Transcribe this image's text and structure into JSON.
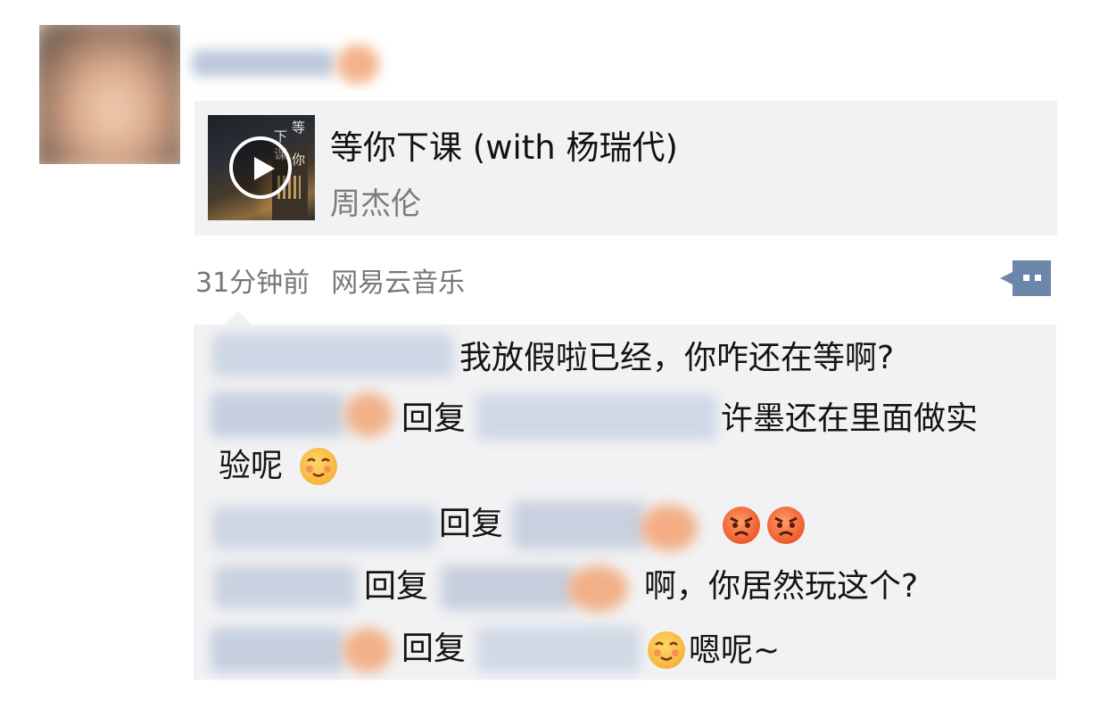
{
  "post": {
    "music": {
      "title": "等你下课 (with 杨瑞代)",
      "artist": "周杰伦",
      "cover_text": [
        "等",
        "你",
        "下",
        "课"
      ]
    },
    "time": "31分钟前",
    "source": "网易云音乐"
  },
  "comments": [
    {
      "text": "我放假啦已经，你咋还在等啊?"
    },
    {
      "reply_label": "回复",
      "text_line1": "许墨还在里面做实",
      "text_line2": "验呢"
    },
    {
      "reply_label": "回复"
    },
    {
      "reply_label": "回复",
      "text": "啊，你居然玩这个?"
    },
    {
      "reply_label": "回复",
      "text": "嗯呢~"
    }
  ],
  "icons": {
    "play": "play-icon",
    "comment": "comment-icon",
    "blush_emoji": "blush-emoji",
    "angry_emoji": "angry-emoji"
  },
  "colors": {
    "card_bg": "#f2f2f4",
    "meta_text": "#777777",
    "comment_button": "#6b86a8"
  }
}
